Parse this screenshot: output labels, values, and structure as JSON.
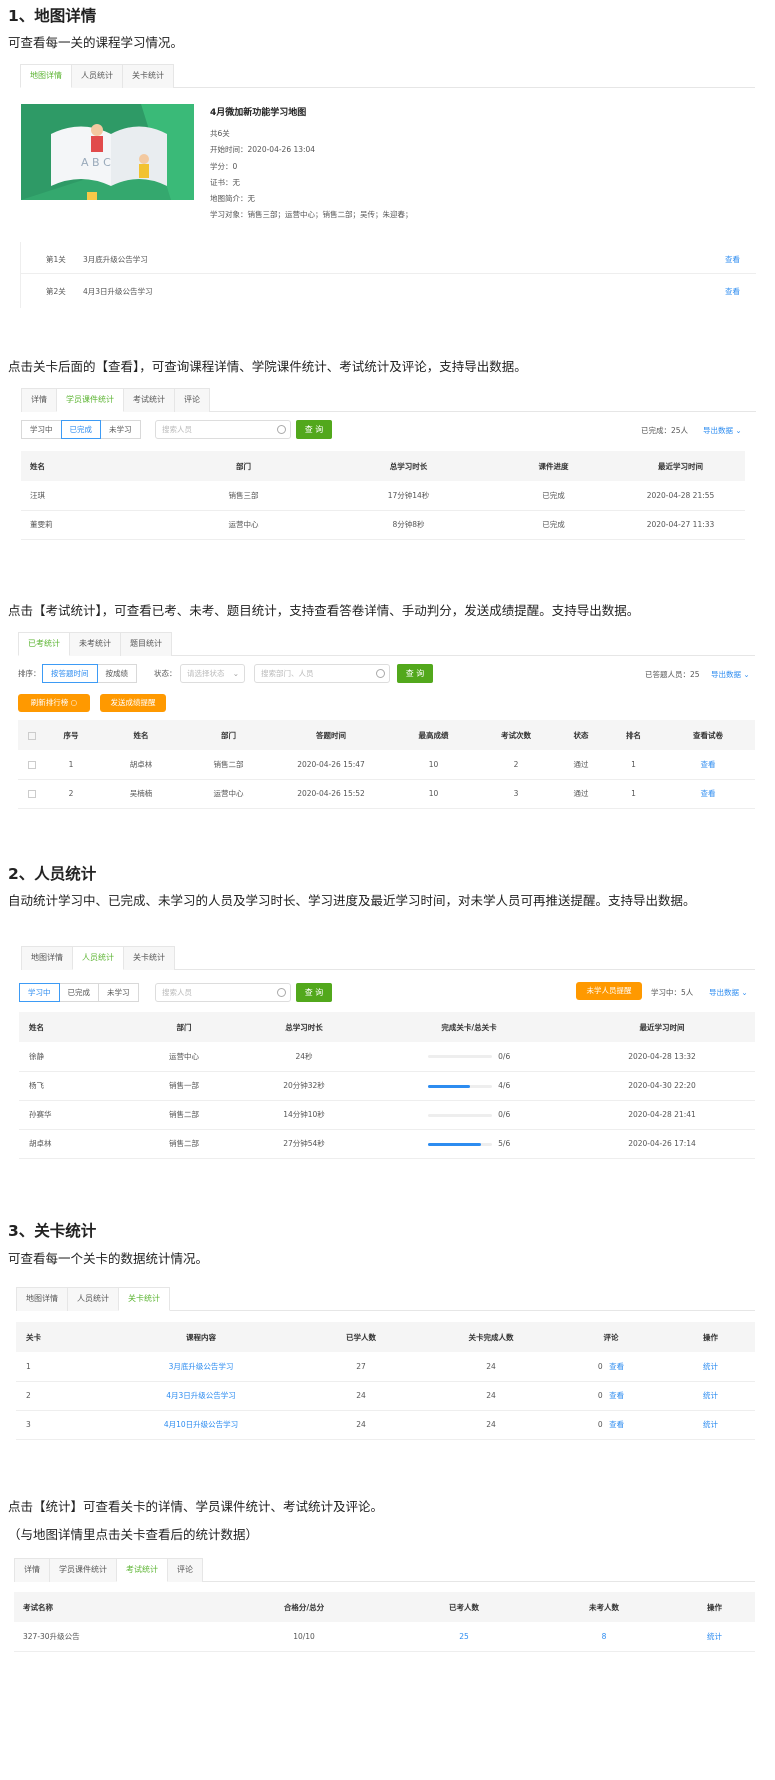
{
  "s1": {
    "title": "1、地图详情",
    "desc": "可查看每一关的课程学习情况。",
    "tabs": [
      "地图详情",
      "人员统计",
      "关卡统计"
    ],
    "map_title": "4月微加新功能学习地图",
    "map_lines": [
      "共6关",
      "开始时间：2020-04-26 13:04",
      "学分：0",
      "证书：无",
      "地图简介：无",
      "学习对象：销售三部；运营中心；销售二部；吴传；朱迎春；"
    ],
    "levels": [
      {
        "idx": "第1关",
        "name": "3月底升级公告学习",
        "act": "查看"
      },
      {
        "idx": "第2关",
        "name": "4月3日升级公告学习",
        "act": "查看"
      }
    ]
  },
  "s1b": {
    "desc": "点击关卡后面的【查看】，可查询课程详情、学院课件统计、考试统计及评论，支持导出数据。",
    "tabs": [
      "详情",
      "学员课件统计",
      "考试统计",
      "评论"
    ],
    "filters": [
      "学习中",
      "已完成",
      "未学习"
    ],
    "search": "搜索人员",
    "query": "查 询",
    "count": "已完成：25人",
    "export": "导出数据",
    "headers": [
      "姓名",
      "部门",
      "总学习时长",
      "课件进度",
      "最近学习时间"
    ],
    "rows": [
      [
        "汪琪",
        "销售三部",
        "17分钟14秒",
        "已完成",
        "2020-04-28 21:55"
      ],
      [
        "董雯莉",
        "运营中心",
        "8分钟8秒",
        "已完成",
        "2020-04-27 11:33"
      ]
    ]
  },
  "s1c": {
    "desc": "点击【考试统计】，可查看已考、未考、题目统计，支持查看答卷详情、手动判分，发送成绩提醒。支持导出数据。",
    "tabs": [
      "已考统计",
      "未考统计",
      "题目统计"
    ],
    "sort_label": "排序：",
    "sorts": [
      "按答题时间",
      "按成绩"
    ],
    "state_label": "状态：",
    "state_ph": "请选择状态",
    "search": "搜索部门、人员",
    "query": "查 询",
    "count": "已答题人员：25",
    "export": "导出数据",
    "btn1": "刷新排行榜",
    "btn2": "发送成绩提醒",
    "headers": [
      "序号",
      "姓名",
      "部门",
      "答题时间",
      "最高成绩",
      "考试次数",
      "状态",
      "排名",
      "查看试卷"
    ],
    "rows": [
      [
        "1",
        "胡卓林",
        "销售二部",
        "2020-04-26 15:47",
        "10",
        "2",
        "通过",
        "1",
        "查看"
      ],
      [
        "2",
        "吴楠楠",
        "运营中心",
        "2020-04-26 15:52",
        "10",
        "3",
        "通过",
        "1",
        "查看"
      ]
    ]
  },
  "s2": {
    "title": "2、人员统计",
    "desc": "自动统计学习中、已完成、未学习的人员及学习时长、学习进度及最近学习时间，对未学人员可再推送提醒。支持导出数据。",
    "tabs": [
      "地图详情",
      "人员统计",
      "关卡统计"
    ],
    "filters": [
      "学习中",
      "已完成",
      "未学习"
    ],
    "search": "搜索人员",
    "query": "查 询",
    "remind": "未学人员提醒",
    "count": "学习中：5人",
    "export": "导出数据",
    "headers": [
      "姓名",
      "部门",
      "总学习时长",
      "完成关卡/总关卡",
      "最近学习时间"
    ],
    "rows": [
      {
        "name": "徐静",
        "dept": "运营中心",
        "time": "24秒",
        "prog": "0/6",
        "p": 0,
        "last": "2020-04-28 13:32"
      },
      {
        "name": "杨飞",
        "dept": "销售一部",
        "time": "20分钟32秒",
        "prog": "4/6",
        "p": 0.667,
        "last": "2020-04-30 22:20"
      },
      {
        "name": "孙赛华",
        "dept": "销售二部",
        "time": "14分钟10秒",
        "prog": "0/6",
        "p": 0,
        "last": "2020-04-28 21:41"
      },
      {
        "name": "胡卓林",
        "dept": "销售二部",
        "time": "27分钟54秒",
        "prog": "5/6",
        "p": 0.833,
        "last": "2020-04-26 17:14"
      }
    ]
  },
  "s3": {
    "title": "3、关卡统计",
    "desc": "可查看每一个关卡的数据统计情况。",
    "tabs": [
      "地图详情",
      "人员统计",
      "关卡统计"
    ],
    "headers": [
      "关卡",
      "课程内容",
      "已学人数",
      "关卡完成人数",
      "评论",
      "操作"
    ],
    "rows": [
      [
        "1",
        "3月底升级公告学习",
        "27",
        "24",
        "0",
        "查看",
        "统计"
      ],
      [
        "2",
        "4月3日升级公告学习",
        "24",
        "24",
        "0",
        "查看",
        "统计"
      ],
      [
        "3",
        "4月10日升级公告学习",
        "24",
        "24",
        "0",
        "查看",
        "统计"
      ]
    ]
  },
  "s3b": {
    "desc1": "点击【统计】可查看关卡的详情、学员课件统计、考试统计及评论。",
    "desc2": "（与地图详情里点击关卡查看后的统计数据）",
    "tabs": [
      "详情",
      "学员课件统计",
      "考试统计",
      "评论"
    ],
    "headers": [
      "考试名称",
      "合格分/总分",
      "已考人数",
      "未考人数",
      "操作"
    ],
    "rows": [
      [
        "327-30升级公告",
        "10/10",
        "25",
        "8",
        "统计"
      ]
    ]
  },
  "colors": {
    "green": "#5bb431",
    "blue": "#2d8cf0",
    "orange": "#ff9900"
  }
}
